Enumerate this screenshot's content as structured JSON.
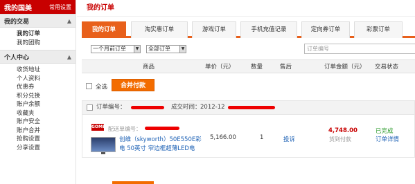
{
  "sidebar": {
    "title": "我的国美",
    "settings_link": "常用设置",
    "sections": [
      {
        "title": "我的交易",
        "items": [
          {
            "label": "我的订单"
          },
          {
            "label": "我的团购"
          }
        ]
      },
      {
        "title": "个人中心",
        "items": [
          {
            "label": "收货地址"
          },
          {
            "label": "个人资料"
          },
          {
            "label": "优惠券"
          },
          {
            "label": "积分兑换"
          },
          {
            "label": "账户余额"
          },
          {
            "label": "收藏夹"
          },
          {
            "label": "账户安全"
          },
          {
            "label": "账户合并"
          },
          {
            "label": "抢购设置"
          },
          {
            "label": "分享设置"
          }
        ]
      }
    ]
  },
  "main": {
    "title": "我的订单",
    "tabs": [
      {
        "label": "我的订单"
      },
      {
        "label": "淘实惠订单"
      },
      {
        "label": "游戏订单"
      },
      {
        "label": "手机充值记录"
      },
      {
        "label": "定向券订单"
      },
      {
        "label": "彩票订单"
      }
    ],
    "filter": {
      "time_select": "一个月前订单",
      "status_select": "全部订单",
      "search_placeholder": "订单编号"
    },
    "columns": [
      "商品",
      "单价（元）",
      "数量",
      "售后",
      "订单金额（元）",
      "交易状态"
    ],
    "select_all_label": "全选",
    "merge_pay_button": "合并付款",
    "order": {
      "order_no_label": "订单编号：",
      "deal_time_label": "成交时间：",
      "deal_time_value": "2012-12",
      "shop_logo": "GOME",
      "delivery_no_label": "配送单编号：",
      "product_title": "创维（skyworth）50E550E彩电 50英寸 窄边框超薄LED电",
      "unit_price": "5,166.00",
      "quantity": "1",
      "after_sale": "投诉",
      "order_amount": "4,748.00",
      "payment_method": "货到付款",
      "status": "已完成",
      "detail_link": "订单详情"
    }
  },
  "colors": {
    "brand_red": "#c80000",
    "accent_orange": "#e8601b",
    "link_blue": "#1a5fb4",
    "status_green": "#2a9a2a"
  }
}
